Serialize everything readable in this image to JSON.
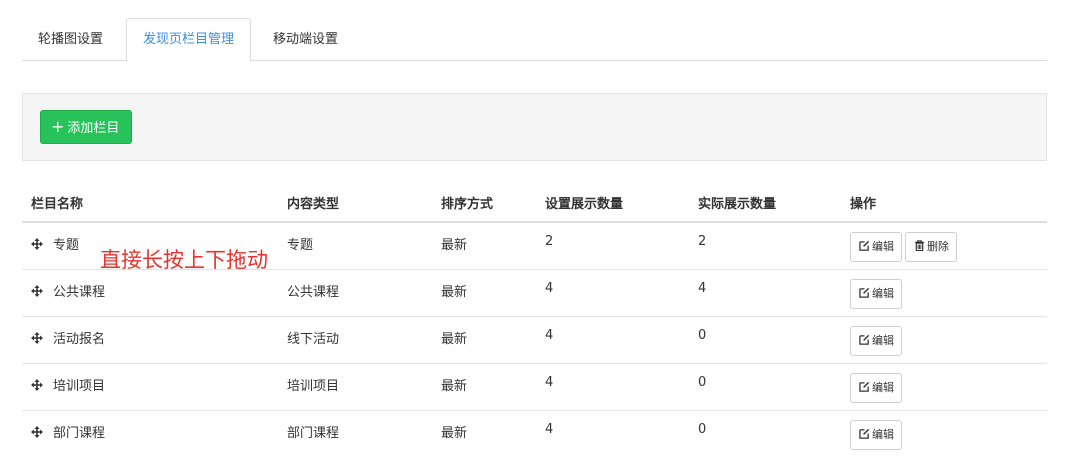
{
  "tabs": [
    {
      "label": "轮播图设置"
    },
    {
      "label": "发现页栏目管理"
    },
    {
      "label": "移动端设置"
    }
  ],
  "toolbar": {
    "add_label": "添加栏目"
  },
  "table": {
    "headers": [
      "栏目名称",
      "内容类型",
      "排序方式",
      "设置展示数量",
      "实际展示数量",
      "操作"
    ],
    "rows": [
      {
        "name": "专题",
        "type": "专题",
        "sort": "最新",
        "set_count": "2",
        "actual_count": "2",
        "actions": [
          "编辑",
          "删除"
        ]
      },
      {
        "name": "公共课程",
        "type": "公共课程",
        "sort": "最新",
        "set_count": "4",
        "actual_count": "4",
        "actions": [
          "编辑"
        ]
      },
      {
        "name": "活动报名",
        "type": "线下活动",
        "sort": "最新",
        "set_count": "4",
        "actual_count": "0",
        "actions": [
          "编辑"
        ]
      },
      {
        "name": "培训项目",
        "type": "培训项目",
        "sort": "最新",
        "set_count": "4",
        "actual_count": "0",
        "actions": [
          "编辑"
        ]
      },
      {
        "name": "部门课程",
        "type": "部门课程",
        "sort": "最新",
        "set_count": "4",
        "actual_count": "0",
        "actions": [
          "编辑"
        ]
      }
    ]
  },
  "annotation": "直接长按上下拖动",
  "colors": {
    "accent": "#3a8ee6",
    "add_button": "#27c25a",
    "annotation": "#e8322e"
  }
}
